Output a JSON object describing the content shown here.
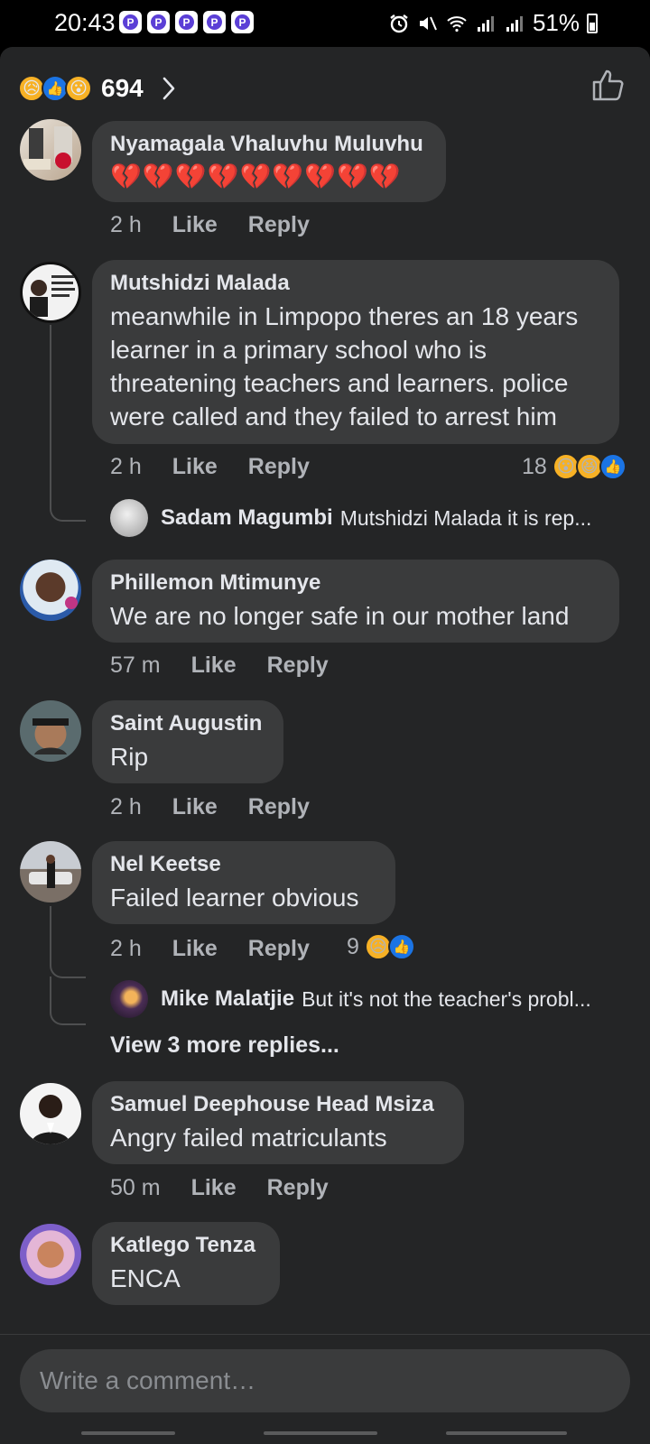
{
  "status": {
    "time": "20:43",
    "app_icons": [
      "P",
      "P",
      "P",
      "P",
      "P"
    ],
    "battery": "51%"
  },
  "header": {
    "reactions": [
      "sad",
      "like",
      "wow"
    ],
    "count": "694"
  },
  "comments": [
    {
      "name": "Nyamagala Vhaluvhu Muluvhu",
      "text": "💔💔💔💔💔💔💔💔💔",
      "time": "2 h",
      "like": "Like",
      "reply": "Reply"
    },
    {
      "name": "Mutshidzi Malada",
      "text": "meanwhile in Limpopo theres an 18 years learner in a primary school who is threatening teachers and learners. police were called and they failed to arrest him",
      "time": "2 h",
      "like": "Like",
      "reply": "Reply",
      "reaction_count": "18",
      "reactions": [
        "wow",
        "haha",
        "like"
      ],
      "reply_preview": {
        "name": "Sadam Magumbi",
        "text": "Mutshidzi Malada it is rep..."
      }
    },
    {
      "name": "Phillemon Mtimunye",
      "text": "We are no longer safe in our mother land",
      "time": "57 m",
      "like": "Like",
      "reply": "Reply"
    },
    {
      "name": "Saint Augustin",
      "text": "Rip",
      "time": "2 h",
      "like": "Like",
      "reply": "Reply"
    },
    {
      "name": "Nel Keetse",
      "text": "Failed learner obvious",
      "time": "2 h",
      "like": "Like",
      "reply": "Reply",
      "reaction_count": "9",
      "reactions": [
        "sad",
        "like"
      ],
      "reply_preview": {
        "name": "Mike Malatjie",
        "text": "But it's not the teacher's probl..."
      },
      "view_more": "View 3 more replies..."
    },
    {
      "name": "Samuel Deephouse Head Msiza",
      "text": "Angry failed matriculants",
      "time": "50 m",
      "like": "Like",
      "reply": "Reply"
    },
    {
      "name": "Katlego Tenza",
      "text": "ENCA"
    }
  ],
  "composer": {
    "placeholder": "Write a comment…"
  },
  "colors": {
    "sheet": "#242526",
    "bubble": "#3a3b3c",
    "like_blue": "#1b74e4",
    "reaction_yellow": "#f7b125",
    "heart_red": "#e0245e"
  }
}
